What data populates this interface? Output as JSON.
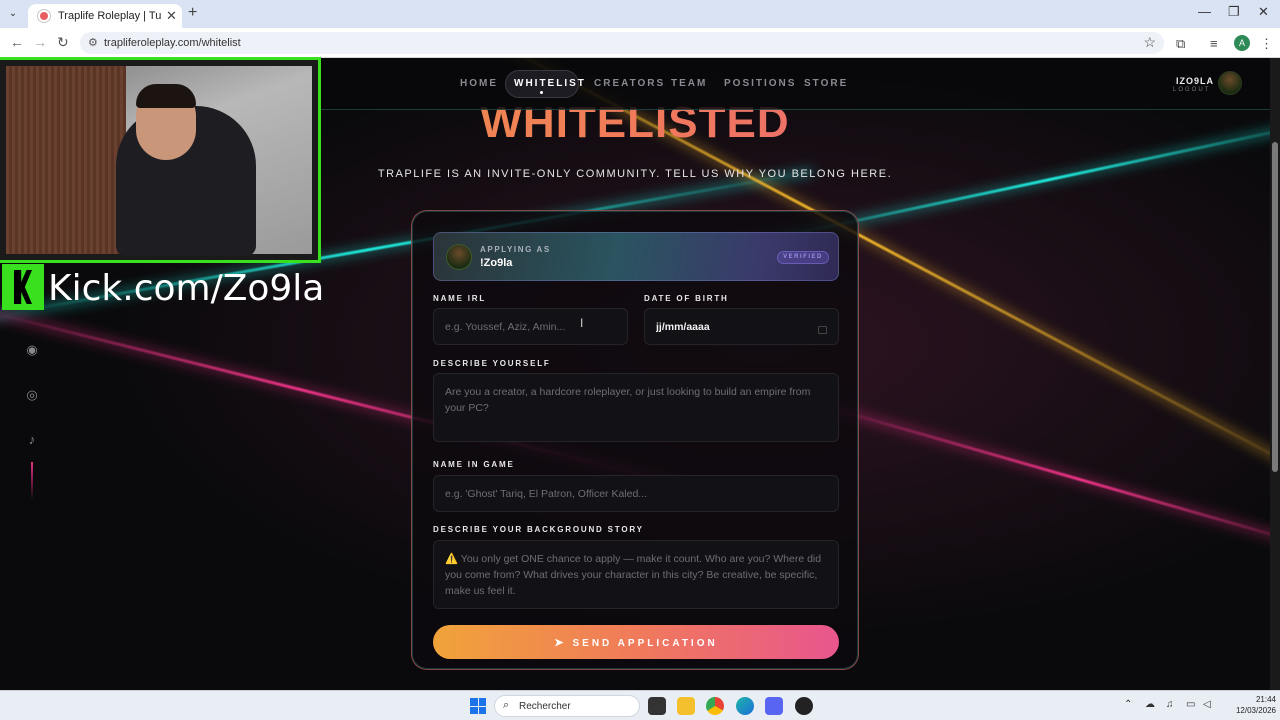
{
  "browser": {
    "tab_title": "Traplife Roleplay | Tunisian GTA",
    "url": "trapliferoleplay.com/whitelist"
  },
  "nav": {
    "links": [
      "HOME",
      "WHITELIST",
      "CREATORS",
      "TEAM",
      "POSITIONS",
      "STORE"
    ],
    "active": "WHITELIST",
    "user_name": "IZO9LA",
    "logout": "LOGOUT"
  },
  "hero": {
    "title": "WHITELISTED",
    "subtitle": "TRAPLIFE IS AN INVITE-ONLY COMMUNITY. TELL US WHY YOU BELONG HERE."
  },
  "form": {
    "applying_label": "APPLYING AS",
    "applying_name": "!Zo9la",
    "verified": "VERIFIED",
    "name_irl_label": "NAME IRL",
    "name_irl_placeholder": "e.g. Youssef, Aziz, Amin...",
    "dob_label": "DATE OF BIRTH",
    "dob_value": "jj/mm/aaaa",
    "describe_label": "DESCRIBE YOURSELF",
    "describe_placeholder": "Are you a creator, a hardcore roleplayer, or just looking to build an empire from your PC?",
    "ingame_label": "NAME IN GAME",
    "ingame_placeholder": "e.g. 'Ghost' Tariq, El Patron, Officer Kaled...",
    "background_label": "DESCRIBE YOUR BACKGROUND STORY",
    "background_placeholder": "⚠️ You only get ONE chance to apply — make it count. Who are you? Where did you come from? What drives your character in this city? Be creative, be specific, make us feel it.",
    "submit": "SEND APPLICATION"
  },
  "overlay": {
    "kick_text": "Kick.com/Zo9la"
  },
  "taskbar": {
    "search": "Rechercher",
    "time": "21:44",
    "date": "12/03/2026"
  },
  "colors": {
    "accent_orange": "#f0a33a",
    "accent_pink": "#e8568e",
    "beam_teal": "#1ee6d8",
    "kick_green": "#39e01e"
  }
}
